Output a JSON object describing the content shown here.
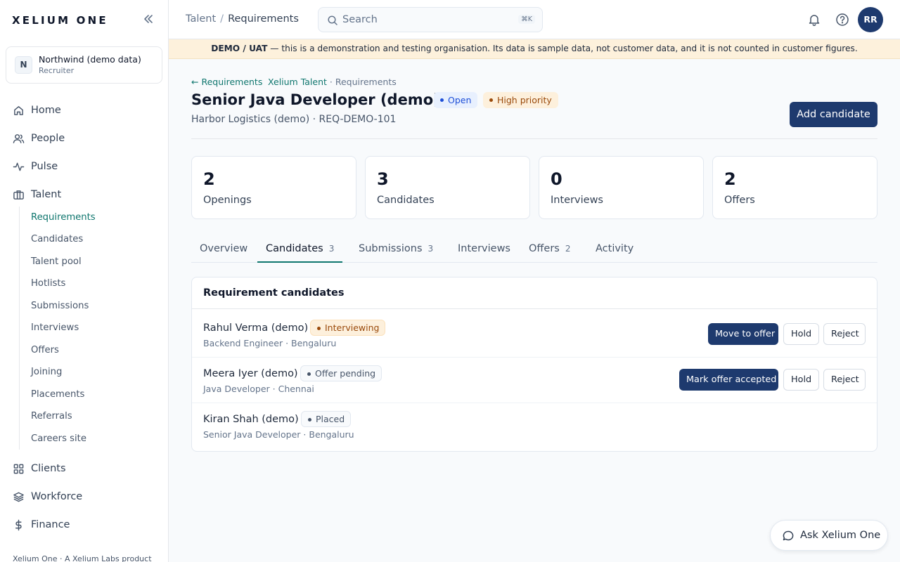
{
  "sidebar": {
    "brand": "XELIUM ONE",
    "org": {
      "initial": "N",
      "name": "Northwind (demo data)",
      "role": "Recruiter"
    },
    "nav": [
      {
        "label": "Home",
        "icon": "home-icon"
      },
      {
        "label": "People",
        "icon": "users-icon"
      },
      {
        "label": "Pulse",
        "icon": "activity-icon"
      },
      {
        "label": "Talent",
        "icon": "briefcase-icon"
      },
      {
        "label": "Clients",
        "icon": "grid-icon"
      },
      {
        "label": "Workforce",
        "icon": "layers-icon"
      },
      {
        "label": "Finance",
        "icon": "dollar-icon"
      }
    ],
    "talent_sub": [
      "Requirements",
      "Candidates",
      "Talent pool",
      "Hotlists",
      "Submissions",
      "Interviews",
      "Offers",
      "Joining",
      "Placements",
      "Referrals",
      "Careers site"
    ],
    "active_sub": "Requirements",
    "footer": "Xelium One · A Xelium Labs product"
  },
  "header": {
    "breadcrumb": [
      "Talent",
      "Requirements"
    ],
    "breadcrumb_sep": "/",
    "search_placeholder": "Search",
    "search_shortcut": "⌘K",
    "user_initials": "RR"
  },
  "banner": {
    "strong": "DEMO / UAT",
    "text": " — this is a demonstration and testing organisation. Its data is sample data, not customer data, and it is not counted in customer figures."
  },
  "requirement": {
    "back_link": "← Requirements",
    "path_app": "Xelium Talent",
    "path_rest": " · Requirements",
    "title": "Senior Java Developer (demo)",
    "status_badge": "Open",
    "priority_badge": "High priority",
    "subtitle": "Harbor Logistics (demo) · REQ-DEMO-101",
    "add_button": "Add candidate"
  },
  "stats": [
    {
      "value": "2",
      "label": "Openings"
    },
    {
      "value": "3",
      "label": "Candidates"
    },
    {
      "value": "0",
      "label": "Interviews"
    },
    {
      "value": "2",
      "label": "Offers"
    }
  ],
  "tabs": [
    {
      "label": "Overview",
      "count": ""
    },
    {
      "label": "Candidates",
      "count": "3"
    },
    {
      "label": "Submissions",
      "count": "3"
    },
    {
      "label": "Interviews",
      "count": ""
    },
    {
      "label": "Offers",
      "count": "2"
    },
    {
      "label": "Activity",
      "count": ""
    }
  ],
  "active_tab": "Candidates",
  "panel": {
    "title": "Requirement candidates",
    "candidates": [
      {
        "name": "Rahul Verma (demo)",
        "status": "Interviewing",
        "meta": "Backend Engineer · Bengaluru",
        "primary_action": "Move to offer",
        "hold": "Hold",
        "reject": "Reject"
      },
      {
        "name": "Meera Iyer (demo)",
        "status": "Offer pending",
        "meta": "Java Developer · Chennai",
        "primary_action": "Mark offer accepted",
        "hold": "Hold",
        "reject": "Reject"
      },
      {
        "name": "Kiran Shah (demo)",
        "status": "Placed",
        "meta": "Senior Java Developer · Bengaluru"
      }
    ]
  },
  "assistant": {
    "label": "Ask Xelium One"
  },
  "colors": {
    "primary": "#1e3a6e",
    "accent": "#0f766e",
    "banner": "#fdf1dc",
    "warning": "#9a4a0b",
    "info": "#1d4ed8"
  }
}
